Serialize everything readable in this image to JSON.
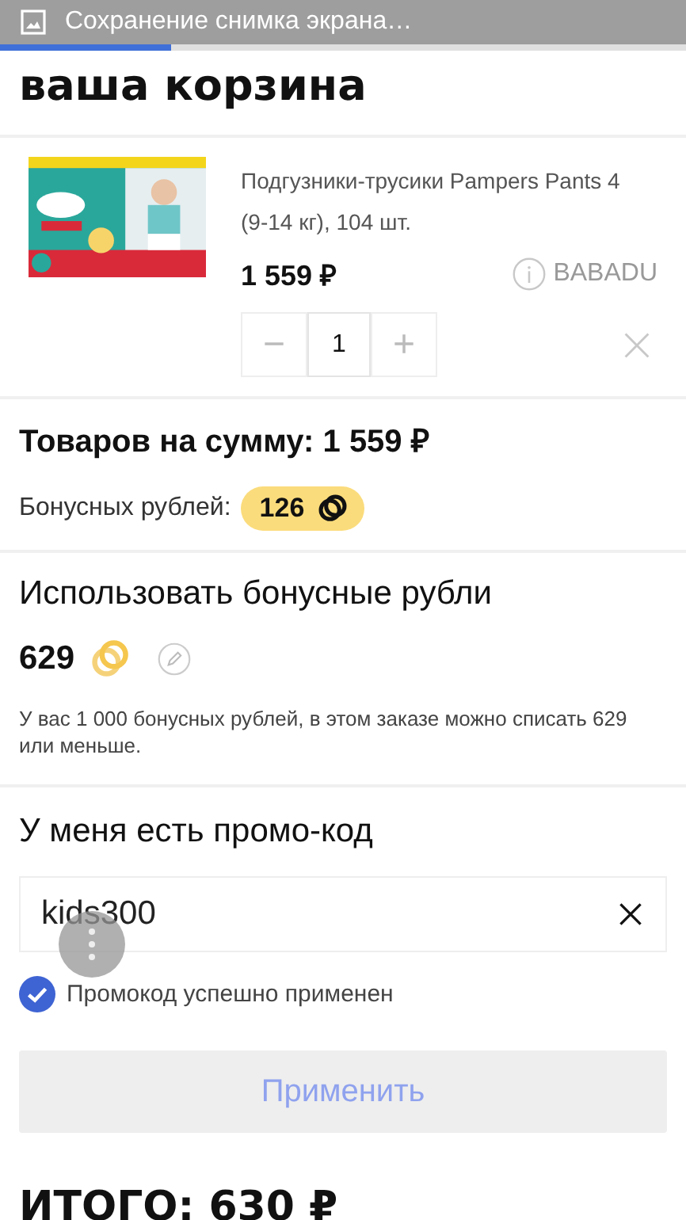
{
  "notification": {
    "text": "Сохранение снимка экрана…",
    "level": 0.25
  },
  "title": "ваша корзина",
  "cart_item": {
    "name": "Подгузники-трусики Pampers Pants 4 (9-14 кг), 104 шт.",
    "price": "1 559 ₽",
    "seller": "BABADU",
    "quantity": "1",
    "minus": "−",
    "plus": "+"
  },
  "summary": {
    "total_label": "Товаров на сумму: 1 559 ₽",
    "bonus_label": "Бонусных рублей:",
    "bonus_value": "126"
  },
  "bonus": {
    "heading": "Использовать бонусные рубли",
    "amount": "629",
    "note": "У вас 1 000 бонусных рублей, в этом заказе можно списать 629 или меньше."
  },
  "promo": {
    "heading": "У меня есть промо-код",
    "value": "kids300",
    "applied": true,
    "status": "Промокод успешно применен",
    "apply_button": {
      "label": "Применить",
      "disabled": true
    }
  },
  "total": "ИТОГО: 630 ₽"
}
